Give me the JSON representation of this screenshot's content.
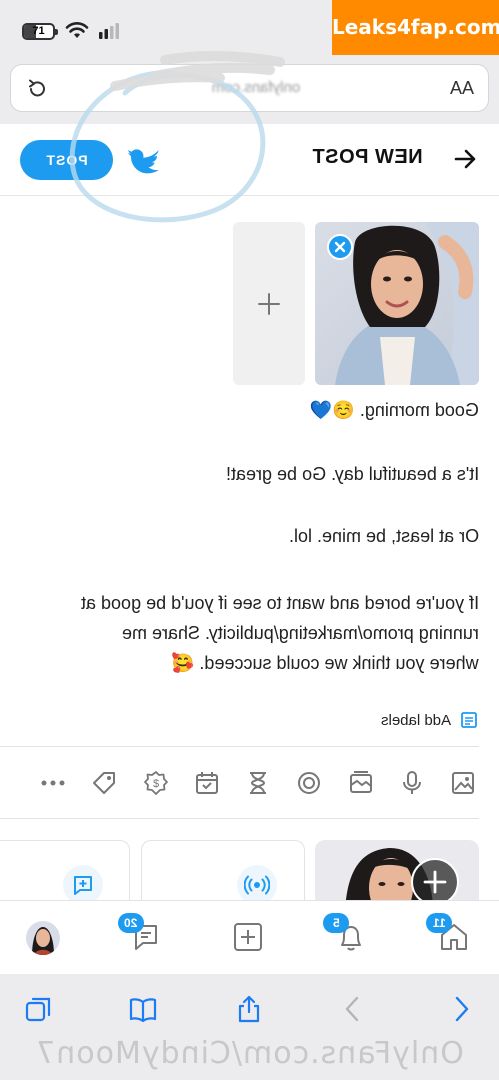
{
  "status_bar": {
    "battery_level": "71",
    "battery_fraction": 0.4,
    "icons": [
      "battery-icon",
      "wifi-icon",
      "signal-icon"
    ]
  },
  "watermark": {
    "text": "Leaks4fap.com",
    "color": "#ff8a00"
  },
  "browser": {
    "url": "onlyfans.com",
    "text_size_label": "AA"
  },
  "header": {
    "title": "NEW POST",
    "post_button": "POST",
    "accent_color": "#1d9bf0"
  },
  "post": {
    "lines": [
      "Good morning. ☺️💙",
      "It's a beautiful day. Go be great!",
      "Or at least, be mine. lol.",
      "If you're bored and want to see if you'd be good at",
      "running promo/marketing/publicity. Share me",
      "where you think we could succeed. 🥰"
    ],
    "labels_action": "Add labels"
  },
  "toolbar": {
    "icons": [
      "image-icon",
      "microphone-icon",
      "gallery-icon",
      "quiz-icon",
      "hourglass-icon",
      "schedule-icon",
      "price-icon",
      "tag-icon",
      "more-icon"
    ]
  },
  "nav": {
    "home_badge": "11",
    "notifications_badge": "5",
    "messages_badge": "20"
  },
  "bottom_url": "OnlyFans.com/CindyMoon7"
}
